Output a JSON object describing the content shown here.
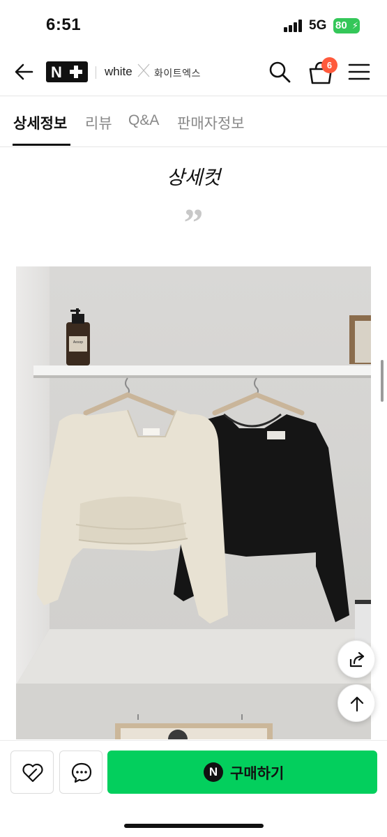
{
  "status_bar": {
    "time": "6:51",
    "network": "5G",
    "battery": "80"
  },
  "header": {
    "logo_text": "N",
    "brand_en": "white",
    "brand_ko": "화이트엑스",
    "cart_count": "6"
  },
  "tabs": [
    {
      "label": "상세정보",
      "active": true
    },
    {
      "label": "리뷰",
      "active": false
    },
    {
      "label": "Q&A",
      "active": false
    },
    {
      "label": "판매자정보",
      "active": false
    }
  ],
  "content": {
    "section_title": "상세컷",
    "quote_mark": "”",
    "photo_shelf_label": "Aesop"
  },
  "bottom_bar": {
    "buy_icon": "N",
    "buy_label": "구매하기"
  },
  "icons": {
    "back": "back-arrow-icon",
    "search": "search-icon",
    "cart": "shopping-bag-icon",
    "menu": "hamburger-menu-icon",
    "share": "share-icon",
    "scroll_top": "arrow-up-icon",
    "wishlist": "heart-icon",
    "chat": "chat-bubble-icon"
  },
  "colors": {
    "accent_green": "#03cf5d",
    "badge_red": "#ff5a3c",
    "battery_green": "#34c759"
  }
}
